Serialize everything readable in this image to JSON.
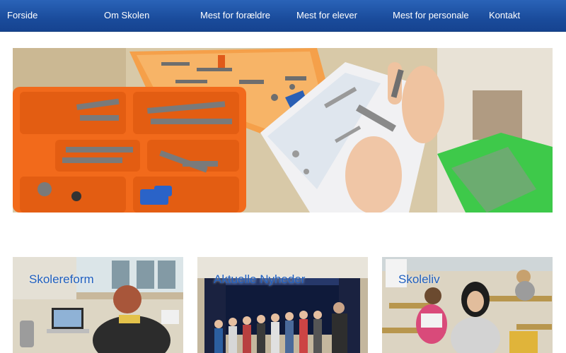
{
  "nav": {
    "items": [
      {
        "label": "Forside"
      },
      {
        "label": "Om Skolen"
      },
      {
        "label": "Mest for forældre"
      },
      {
        "label": "Mest for elever"
      },
      {
        "label": "Mest for personale"
      },
      {
        "label": "Kontakt"
      }
    ]
  },
  "hero": {
    "image": "lego-robotics-kit-photo"
  },
  "cards": [
    {
      "title": "Skolereform",
      "image": "classroom-teacher-photo"
    },
    {
      "title": "Aktuelle Nyheder",
      "image": "children-choir-stage-photo"
    },
    {
      "title": "Skoleliv",
      "image": "students-classroom-photo"
    }
  ],
  "colors": {
    "nav_bg": "#1a4c9c",
    "card_title": "#1f5fbf",
    "lego_orange": "#f26a1b"
  }
}
